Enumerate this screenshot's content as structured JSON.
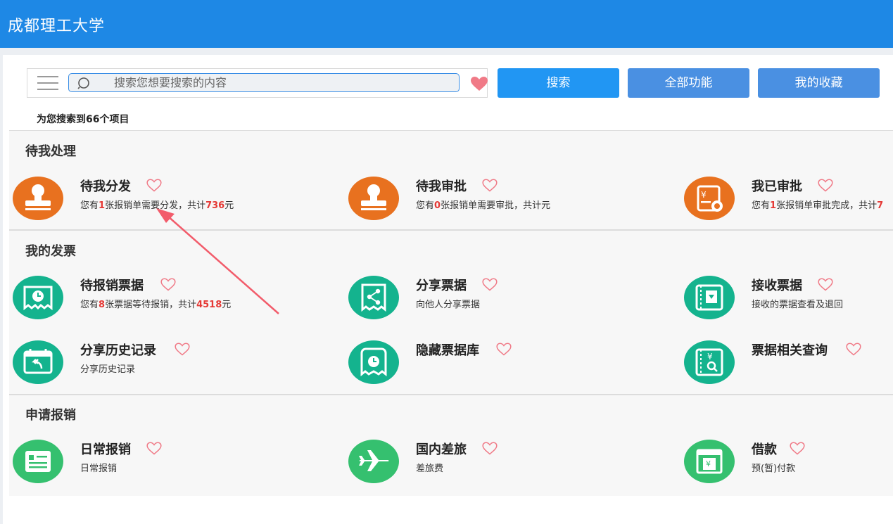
{
  "app": {
    "title": "成都理工大学"
  },
  "search": {
    "placeholder": "搜索您想要搜索的内容",
    "buttons": {
      "search": "搜索",
      "all": "全部功能",
      "favorites": "我的收藏"
    },
    "result_count": "为您搜索到66个项目"
  },
  "sections": [
    {
      "title": "待我处理",
      "items": [
        {
          "title": "待我分发",
          "desc_parts": [
            "您有",
            "1",
            "张报销单需要分发，共计",
            "736",
            "元"
          ],
          "icon": "stamp-icon"
        },
        {
          "title": "待我审批",
          "desc_parts": [
            "您有",
            "0",
            "张报销单需要审批，共计元"
          ],
          "icon": "stamp-icon"
        },
        {
          "title": "我已审批",
          "desc_parts": [
            "您有",
            "1",
            "张报销单审批完成，共计",
            "7"
          ],
          "icon": "approved-invoice-icon"
        }
      ]
    },
    {
      "title": "我的发票",
      "items": [
        {
          "title": "待报销票据",
          "desc_parts": [
            "您有",
            "8",
            "张票据等待报销，共计",
            "4518",
            "元"
          ],
          "icon": "pending-receipt-icon"
        },
        {
          "title": "分享票据",
          "desc_parts": [
            "向他人分享票据"
          ],
          "icon": "share-receipt-icon"
        },
        {
          "title": "接收票据",
          "desc_parts": [
            "接收的票据查看及退回"
          ],
          "icon": "receive-receipt-icon"
        },
        {
          "title": "分享历史记录",
          "desc_parts": [
            "分享历史记录"
          ],
          "icon": "share-history-icon"
        },
        {
          "title": "隐藏票据库",
          "desc_parts": [],
          "icon": "hidden-receipt-icon"
        },
        {
          "title": "票据相关查询",
          "desc_parts": [],
          "icon": "receipt-query-icon"
        }
      ]
    },
    {
      "title": "申请报销",
      "items": [
        {
          "title": "日常报销",
          "desc_parts": [
            "日常报销"
          ],
          "icon": "daily-expense-icon"
        },
        {
          "title": "国内差旅",
          "desc_parts": [
            "差旅费"
          ],
          "icon": "airplane-icon"
        },
        {
          "title": "借款",
          "desc_parts": [
            "预(暂)付款"
          ],
          "icon": "loan-icon"
        }
      ]
    }
  ],
  "colors": {
    "topbar": "#1e88e5",
    "primary_button": "#2196f3",
    "secondary_button": "#4a90e2",
    "icon_orange": "#e8711f",
    "icon_teal": "#14b38e",
    "icon_green": "#35c06f",
    "heart": "#f07a87",
    "highlight_number": "#e53935",
    "annotation_arrow": "#f25c6b"
  }
}
